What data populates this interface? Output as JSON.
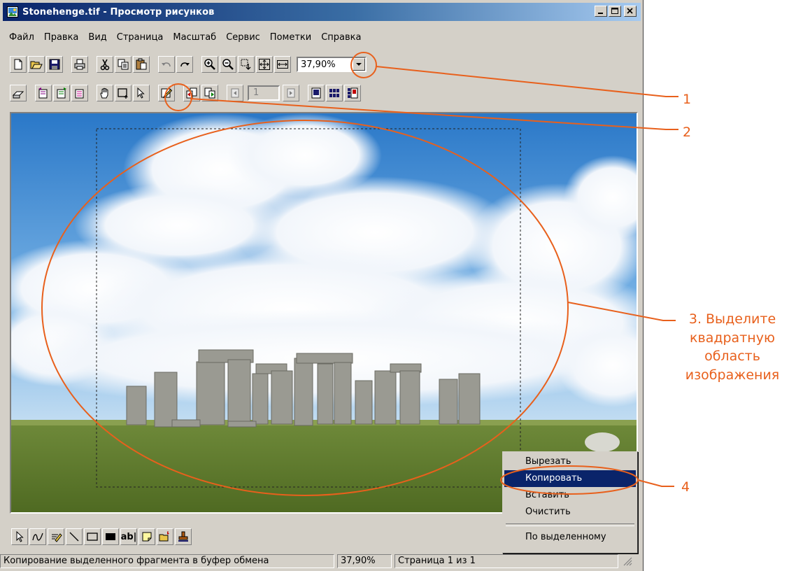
{
  "window": {
    "title": "Stonehenge.tif - Просмотр рисунков",
    "controls": [
      "minimize-icon",
      "maximize-icon",
      "close-icon"
    ]
  },
  "menu": [
    "Файл",
    "Правка",
    "Вид",
    "Страница",
    "Масштаб",
    "Сервис",
    "Пометки",
    "Справка"
  ],
  "toolbar1": {
    "buttons": [
      "new-icon",
      "open-icon",
      "save-icon",
      "print-icon",
      "cut-icon",
      "copy-icon",
      "paste-icon",
      "undo-icon",
      "redo-icon",
      "zoom-in-icon",
      "zoom-out-icon",
      "zoom-rectangle-icon",
      "best-fit-icon",
      "fit-width-icon"
    ],
    "zoom": "37,90%"
  },
  "toolbar2": {
    "buttons": [
      "scan-icon",
      "rotate-left-icon",
      "rotate-right-icon",
      "flip-icon",
      "pan-hand-icon",
      "select-rectangle-icon",
      "pointer-icon",
      "annotation-edit-icon",
      "page-insert-icon",
      "page-append-icon",
      "prev-page-icon",
      "next-page-icon",
      "single-page-icon",
      "thumbnails-icon",
      "page-and-thumbnails-icon"
    ],
    "page_number": "1"
  },
  "bottom_toolbar": {
    "buttons": [
      "select-annotation-icon",
      "freehand-line-icon",
      "highlighter-icon",
      "straight-line-icon",
      "hollow-rectangle-icon",
      "filled-rectangle-icon",
      "text-icon",
      "note-icon",
      "text-from-file-icon",
      "stamp-icon"
    ],
    "text_tool_label": "ab|"
  },
  "context_menu": {
    "items": [
      "Вырезать",
      "Копировать",
      "Вставить",
      "Очистить"
    ],
    "bottom_item": "По выделенному",
    "active": "Копировать"
  },
  "status": {
    "message": "Копирование выделенного фрагмента в буфер обмена",
    "zoom": "37,90%",
    "page": "Страница 1 из 1"
  },
  "callouts": {
    "c1": "1",
    "c2": "2",
    "c3_lines": [
      "3. Выделите",
      "квадратную",
      "область",
      "изображения"
    ],
    "c4": "4"
  },
  "colors": {
    "annotation": "#e8601c",
    "title_bar": "#0a246a",
    "menu_highlight": "#0a246a"
  }
}
